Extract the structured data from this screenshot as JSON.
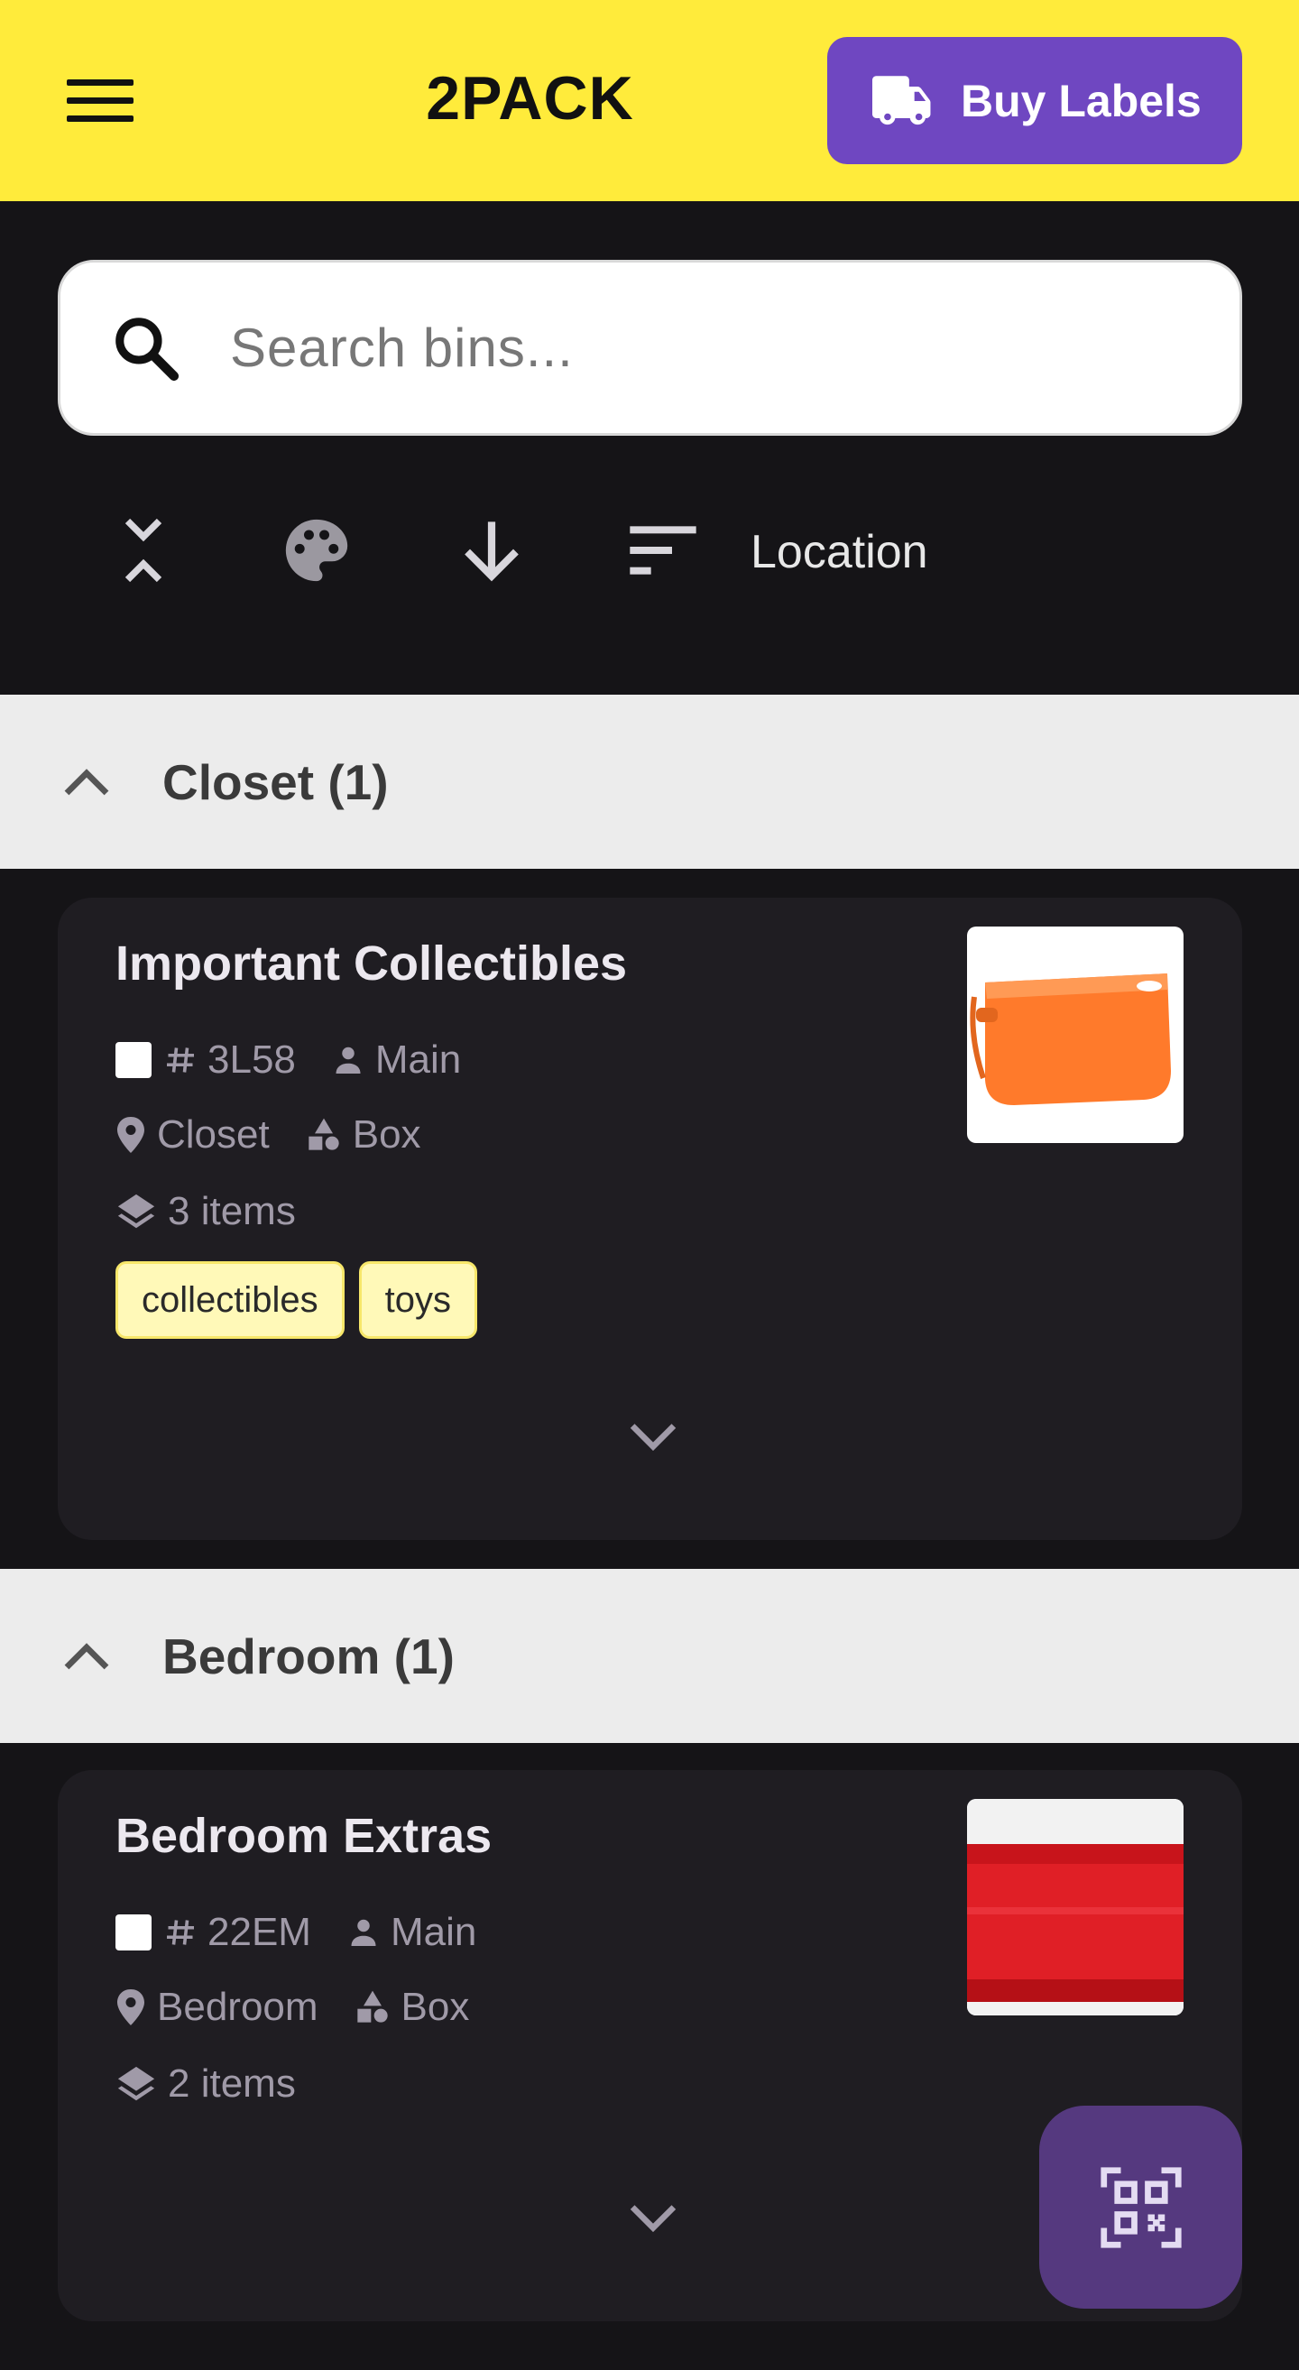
{
  "header": {
    "title": "2PACK",
    "buy_labels": "Buy Labels"
  },
  "search": {
    "placeholder": "Search bins..."
  },
  "toolbar": {
    "sort_by": "Location",
    "icons": [
      "collapse-all-icon",
      "palette-icon",
      "arrow-down-icon",
      "sort-icon"
    ]
  },
  "groups": [
    {
      "header": "Closet (1)",
      "bins": [
        {
          "title": "Important Collectibles",
          "code": "3L58",
          "owner": "Main",
          "location": "Closet",
          "type": "Box",
          "items": "3 items",
          "tags": [
            "collectibles",
            "toys"
          ],
          "image_color": "#ff7a2b"
        }
      ]
    },
    {
      "header": "Bedroom (1)",
      "bins": [
        {
          "title": "Bedroom Extras",
          "code": "22EM",
          "owner": "Main",
          "location": "Bedroom",
          "type": "Box",
          "items": "2 items",
          "tags": [],
          "image_color": "#e01f26"
        }
      ]
    }
  ],
  "colors": {
    "header_bg": "#ffeb3b",
    "accent": "#6f47c1",
    "fab": "#55397f",
    "page_bg": "#151417",
    "card_bg": "#1f1d22",
    "tag_bg": "#fff9b8"
  }
}
